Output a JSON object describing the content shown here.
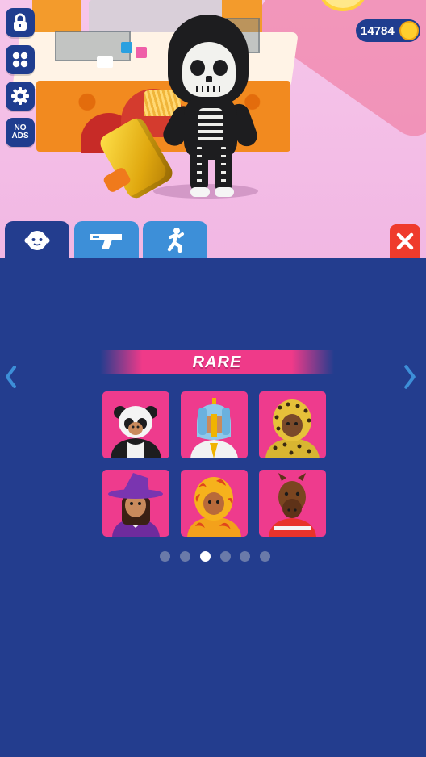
{
  "hud": {
    "side_buttons": [
      {
        "name": "lock-button",
        "icon": "lock-icon"
      },
      {
        "name": "menu-button",
        "icon": "four-dots-icon"
      },
      {
        "name": "settings-button",
        "icon": "gear-icon"
      },
      {
        "name": "no-ads-button",
        "icon": "no-ads-icon"
      }
    ],
    "no_ads_label_line1": "NO",
    "no_ads_label_line2": "ADS",
    "coins": "14784"
  },
  "tabs": [
    {
      "name": "tab-skins",
      "icon": "face-icon",
      "active": true
    },
    {
      "name": "tab-weapons",
      "icon": "gun-icon",
      "active": false
    },
    {
      "name": "tab-emotes",
      "icon": "running-figure-icon",
      "active": false
    }
  ],
  "close_icon": "close-icon",
  "shop": {
    "rarity": "RARE",
    "items": [
      {
        "name": "skin-panda",
        "color": "#1d1d1f"
      },
      {
        "name": "skin-knight",
        "color": "#8fc8ea"
      },
      {
        "name": "skin-leopard",
        "color": "#d8b531"
      },
      {
        "name": "skin-witch",
        "color": "#6e2b9d"
      },
      {
        "name": "skin-flame",
        "color": "#f3a11b"
      },
      {
        "name": "skin-horse",
        "color": "#7a4520"
      }
    ],
    "page_count": 6,
    "current_page": 3
  },
  "colors": {
    "panel_bg": "#233d8e",
    "tab_inactive": "#3d8fd8",
    "card_bg": "#ee3b8d",
    "close_bg": "#ef3b2c",
    "accent_arrow": "#3d8fd8"
  }
}
